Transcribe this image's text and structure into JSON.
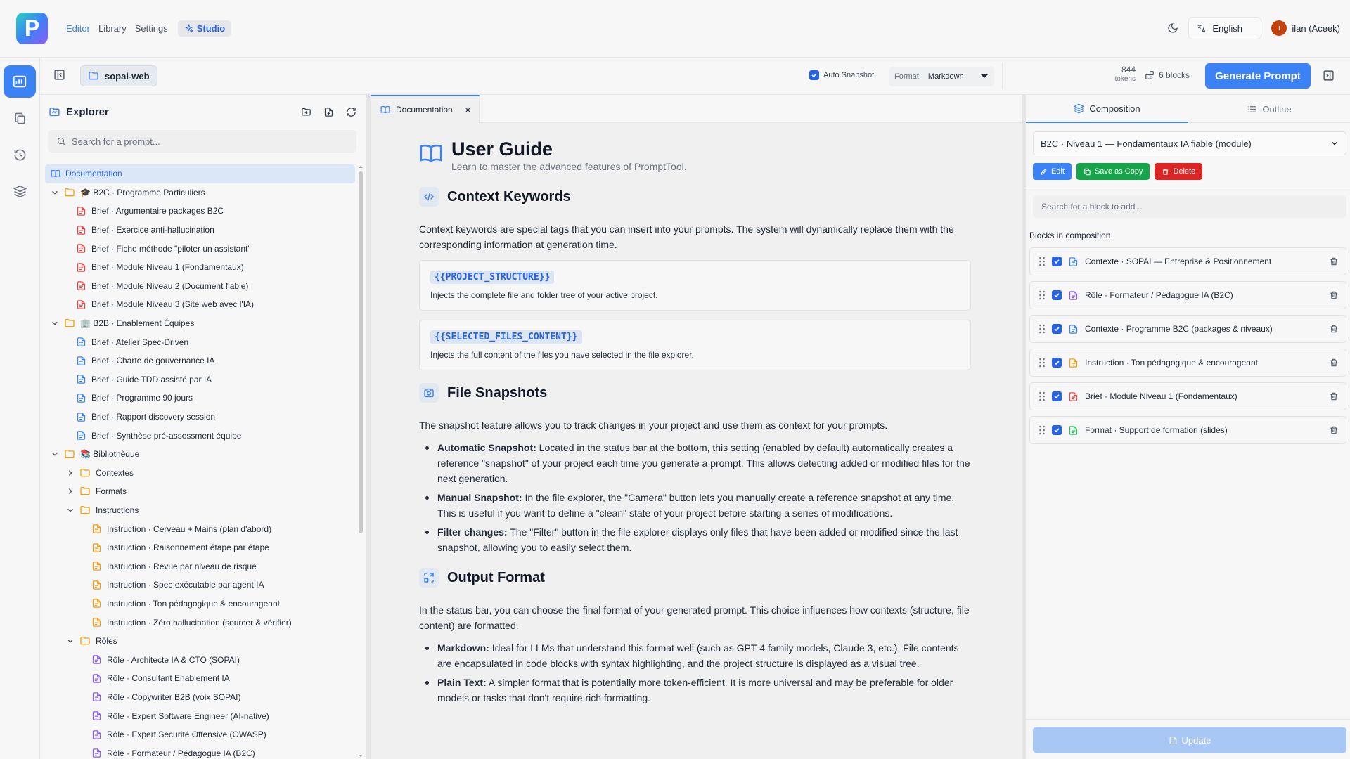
{
  "app": {
    "logo_letter": "P",
    "nav": [
      "Editor",
      "Library",
      "Settings"
    ],
    "nav_active": "Studio",
    "language": "English",
    "user": {
      "name": "ilan (Aceek)",
      "avatar_initial": "i"
    }
  },
  "toolbar": {
    "project": "sopai-web",
    "auto_snapshot_label": "Auto Snapshot",
    "auto_snapshot_checked": true,
    "format_label": "Format:",
    "format_value": "Markdown",
    "tokens_count": "844",
    "tokens_label": "tokens",
    "blocks_count": "6 blocks",
    "generate_label": "Generate Prompt"
  },
  "explorer": {
    "title": "Explorer",
    "search_placeholder": "Search for a prompt...",
    "tree": [
      {
        "label": "Documentation",
        "type": "doc",
        "depth": 0,
        "selected": true
      },
      {
        "label": "🎓 B2C · Programme Particuliers",
        "type": "folder",
        "depth": 0,
        "open": true
      },
      {
        "label": "Brief · Argumentaire packages B2C",
        "type": "file-red",
        "depth": 1
      },
      {
        "label": "Brief · Exercice anti-hallucination",
        "type": "file-red",
        "depth": 1
      },
      {
        "label": "Brief · Fiche méthode \"piloter un assistant\"",
        "type": "file-red",
        "depth": 1
      },
      {
        "label": "Brief · Module Niveau 1 (Fondamentaux)",
        "type": "file-red",
        "depth": 1
      },
      {
        "label": "Brief · Module Niveau 2 (Document fiable)",
        "type": "file-red",
        "depth": 1
      },
      {
        "label": "Brief · Module Niveau 3 (Site web avec l'IA)",
        "type": "file-red",
        "depth": 1
      },
      {
        "label": "🏢 B2B · Enablement Équipes",
        "type": "folder",
        "depth": 0,
        "open": true
      },
      {
        "label": "Brief · Atelier Spec-Driven",
        "type": "file-blue",
        "depth": 1
      },
      {
        "label": "Brief · Charte de gouvernance IA",
        "type": "file-blue",
        "depth": 1
      },
      {
        "label": "Brief · Guide TDD assisté par IA",
        "type": "file-blue",
        "depth": 1
      },
      {
        "label": "Brief · Programme 90 jours",
        "type": "file-blue",
        "depth": 1
      },
      {
        "label": "Brief · Rapport discovery session",
        "type": "file-blue",
        "depth": 1
      },
      {
        "label": "Brief · Synthèse pré-assessment équipe",
        "type": "file-blue",
        "depth": 1
      },
      {
        "label": "📚 Bibliothèque",
        "type": "folder",
        "depth": 0,
        "open": true
      },
      {
        "label": "Contextes",
        "type": "folder",
        "depth": 1,
        "open": false
      },
      {
        "label": "Formats",
        "type": "folder",
        "depth": 1,
        "open": false
      },
      {
        "label": "Instructions",
        "type": "folder",
        "depth": 1,
        "open": true
      },
      {
        "label": "Instruction · Cerveau + Mains (plan d'abord)",
        "type": "file-orange",
        "depth": 2
      },
      {
        "label": "Instruction · Raisonnement étape par étape",
        "type": "file-orange",
        "depth": 2
      },
      {
        "label": "Instruction · Revue par niveau de risque",
        "type": "file-orange",
        "depth": 2
      },
      {
        "label": "Instruction · Spec exécutable par agent IA",
        "type": "file-orange",
        "depth": 2
      },
      {
        "label": "Instruction · Ton pédagogique & encourageant",
        "type": "file-orange",
        "depth": 2
      },
      {
        "label": "Instruction · Zéro hallucination (sourcer & vérifier)",
        "type": "file-orange",
        "depth": 2
      },
      {
        "label": "Rôles",
        "type": "folder",
        "depth": 1,
        "open": true
      },
      {
        "label": "Rôle · Architecte IA & CTO (SOPAI)",
        "type": "file-purple",
        "depth": 2
      },
      {
        "label": "Rôle · Consultant Enablement IA",
        "type": "file-purple",
        "depth": 2
      },
      {
        "label": "Rôle · Copywriter B2B (voix SOPAI)",
        "type": "file-purple",
        "depth": 2
      },
      {
        "label": "Rôle · Expert Software Engineer (AI-native)",
        "type": "file-purple",
        "depth": 2
      },
      {
        "label": "Rôle · Expert Sécurité Offensive (OWASP)",
        "type": "file-purple",
        "depth": 2
      },
      {
        "label": "Rôle · Formateur / Pédagogue IA (B2C)",
        "type": "file-purple",
        "depth": 2
      }
    ]
  },
  "doc": {
    "tab_label": "Documentation",
    "title": "User Guide",
    "subtitle": "Learn to master the advanced features of PromptTool.",
    "s1": {
      "title": "Context Keywords",
      "intro": "Context keywords are special tags that you can insert into your prompts. The system will dynamically replace them with the corresponding information at generation time.",
      "kw1": {
        "code": "{{PROJECT_STRUCTURE}}",
        "desc": "Injects the complete file and folder tree of your active project."
      },
      "kw2": {
        "code": "{{SELECTED_FILES_CONTENT}}",
        "desc": "Injects the full content of the files you have selected in the file explorer."
      }
    },
    "s2": {
      "title": "File Snapshots",
      "intro": "The snapshot feature allows you to track changes in your project and use them as context for your prompts.",
      "b1_title": "Automatic Snapshot:",
      "b1_text": " Located in the status bar at the bottom, this setting (enabled by default) automatically creates a reference \"snapshot\" of your project each time you generate a prompt. This allows detecting added or modified files for the next generation.",
      "b2_title": "Manual Snapshot:",
      "b2_text": " In the file explorer, the \"Camera\" button lets you manually create a reference snapshot at any time. This is useful if you want to define a \"clean\" state of your project before starting a series of modifications.",
      "b3_title": "Filter changes:",
      "b3_text": " The \"Filter\" button in the file explorer displays only files that have been added or modified since the last snapshot, allowing you to easily select them."
    },
    "s3": {
      "title": "Output Format",
      "intro": "In the status bar, you can choose the final format of your generated prompt. This choice influences how contexts (structure, file content) are formatted.",
      "b1_title": "Markdown:",
      "b1_text": " Ideal for LLMs that understand this format well (such as GPT-4 family models, Claude 3, etc.). File contents are encapsulated in code blocks with syntax highlighting, and the project structure is displayed as a visual tree.",
      "b2_title": "Plain Text:",
      "b2_text": " A simpler format that is potentially more token-efficient. It is more universal and may be preferable for older models or tasks that don't require rich formatting."
    }
  },
  "composition": {
    "tab_composition": "Composition",
    "tab_outline": "Outline",
    "selected": "B2C · Niveau 1 — Fondamentaux IA fiable (module)",
    "edit_label": "Edit",
    "copy_label": "Save as Copy",
    "delete_label": "Delete",
    "search_placeholder": "Search for a block to add...",
    "blocks_title": "Blocks in composition",
    "blocks": [
      {
        "label": "Contexte · SOPAI — Entreprise & Positionnement",
        "color": "#3b82f6"
      },
      {
        "label": "Rôle · Formateur / Pédagogue IA (B2C)",
        "color": "#8b5cf6"
      },
      {
        "label": "Contexte · Programme B2C (packages & niveaux)",
        "color": "#3b82f6"
      },
      {
        "label": "Instruction · Ton pédagogique & encourageant",
        "color": "#f59e0b"
      },
      {
        "label": "Brief · Module Niveau 1 (Fondamentaux)",
        "color": "#ef4444"
      },
      {
        "label": "Format · Support de formation (slides)",
        "color": "#22c55e"
      }
    ],
    "update_label": "Update"
  },
  "colors": {
    "accent": "#3b82f6",
    "success": "#16a34a",
    "danger": "#dc2626"
  }
}
